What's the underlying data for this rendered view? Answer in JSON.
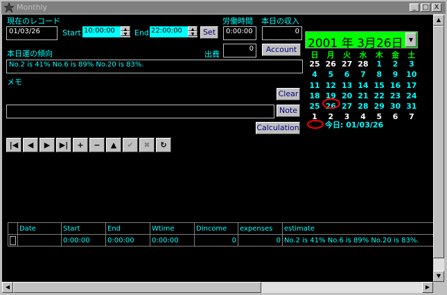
{
  "window": {
    "title": "Monthly",
    "minimize": "_",
    "maximize": "□",
    "close": "X"
  },
  "record": {
    "label": "現在のレコード",
    "date": "01/03/26"
  },
  "time": {
    "start_label": "Start",
    "start_value": "10:00:00",
    "end_label": "End",
    "end_value": "22:00:00",
    "set_label": "Set"
  },
  "labor": {
    "label": "労働時間",
    "value": "0:00:00"
  },
  "income": {
    "label": "本日の収入",
    "value": "0"
  },
  "expense": {
    "label": "出費",
    "value": "0"
  },
  "account_label": "Account",
  "luck": {
    "label": "本日運の傾向",
    "value": "No.2 is 41% No.6 is 89% No.20 is 83%."
  },
  "memo": {
    "label": "メモ",
    "value": ""
  },
  "buttons": {
    "clear": "Clear",
    "note": "Note",
    "calculation": "Calculation"
  },
  "navigator": {
    "first": "|◀",
    "prior": "◀",
    "next": "▶",
    "last": "▶|",
    "insert": "+",
    "delete": "−",
    "edit": "▲",
    "post": "✔",
    "cancel": "✖",
    "refresh": "↻"
  },
  "calendar": {
    "header": "2001 年  3月26日",
    "weekdays": [
      "日",
      "月",
      "火",
      "水",
      "木",
      "金",
      "土"
    ],
    "weeks": [
      [
        "25",
        "26",
        "27",
        "28",
        "1",
        "2",
        "3"
      ],
      [
        "4",
        "5",
        "6",
        "7",
        "8",
        "9",
        "10"
      ],
      [
        "11",
        "12",
        "13",
        "14",
        "15",
        "16",
        "17"
      ],
      [
        "18",
        "19",
        "20",
        "21",
        "22",
        "23",
        "24"
      ],
      [
        "25",
        "26",
        "27",
        "28",
        "29",
        "30",
        "31"
      ],
      [
        "1",
        "2",
        "3",
        "4",
        "5",
        "6",
        "7"
      ]
    ],
    "today_label": "今日: 01/03/26",
    "colors": {
      "weekday": "#00ff00",
      "in_month": "#00ffff",
      "out_month": "#ffffff",
      "header_bg": "#00ff00",
      "today_circle": "#ff0000"
    }
  },
  "table": {
    "columns": [
      "Date",
      "Start",
      "End",
      "Wtime",
      "Dincome",
      "expenses",
      "estimate"
    ],
    "rows": [
      [
        "",
        "0:00:00",
        "0:00:00",
        "0:00:00",
        "0",
        "0",
        "No.2 is 41% No.6 is 89% No.20 is 83%."
      ]
    ]
  }
}
